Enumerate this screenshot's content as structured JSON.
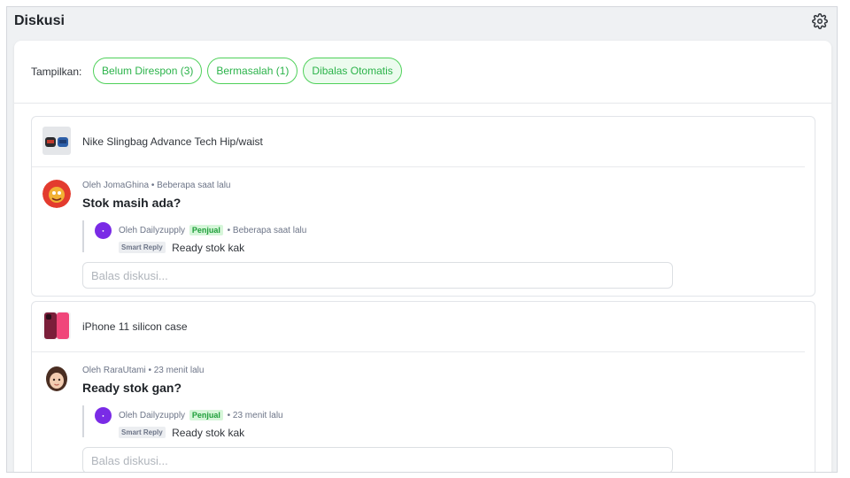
{
  "header": {
    "title": "Diskusi",
    "settings_icon": "gear-icon"
  },
  "filters": {
    "label": "Tampilkan:",
    "chips": [
      {
        "label": "Belum Direspon (3)",
        "active": false
      },
      {
        "label": "Bermasalah (1)",
        "active": false
      },
      {
        "label": "Dibalas Otomatis",
        "active": true
      }
    ]
  },
  "colors": {
    "accent": "#2bb34a",
    "accent_border": "#4fd15a",
    "seller_avatar": "#7a2be6"
  },
  "discussions": [
    {
      "product_name": "Nike Slingbag Advance Tech Hip/waist",
      "question_meta": "Oleh JomaGhina • Beberapa saat lalu",
      "question": "Stok masih ada?",
      "reply": {
        "meta_prefix": "Oleh Dailyzupply",
        "seller_badge": "Penjual",
        "meta_suffix": "• Beberapa saat lalu",
        "smart_badge": "Smart Reply",
        "text": "Ready stok kak"
      },
      "input_placeholder": "Balas diskusi..."
    },
    {
      "product_name": "iPhone 11 silicon case",
      "question_meta": "Oleh RaraUtami • 23 menit lalu",
      "question": "Ready stok gan?",
      "reply": {
        "meta_prefix": "Oleh Dailyzupply",
        "seller_badge": "Penjual",
        "meta_suffix": "• 23 menit lalu",
        "smart_badge": "Smart Reply",
        "text": "Ready stok kak"
      },
      "input_placeholder": "Balas diskusi..."
    }
  ]
}
